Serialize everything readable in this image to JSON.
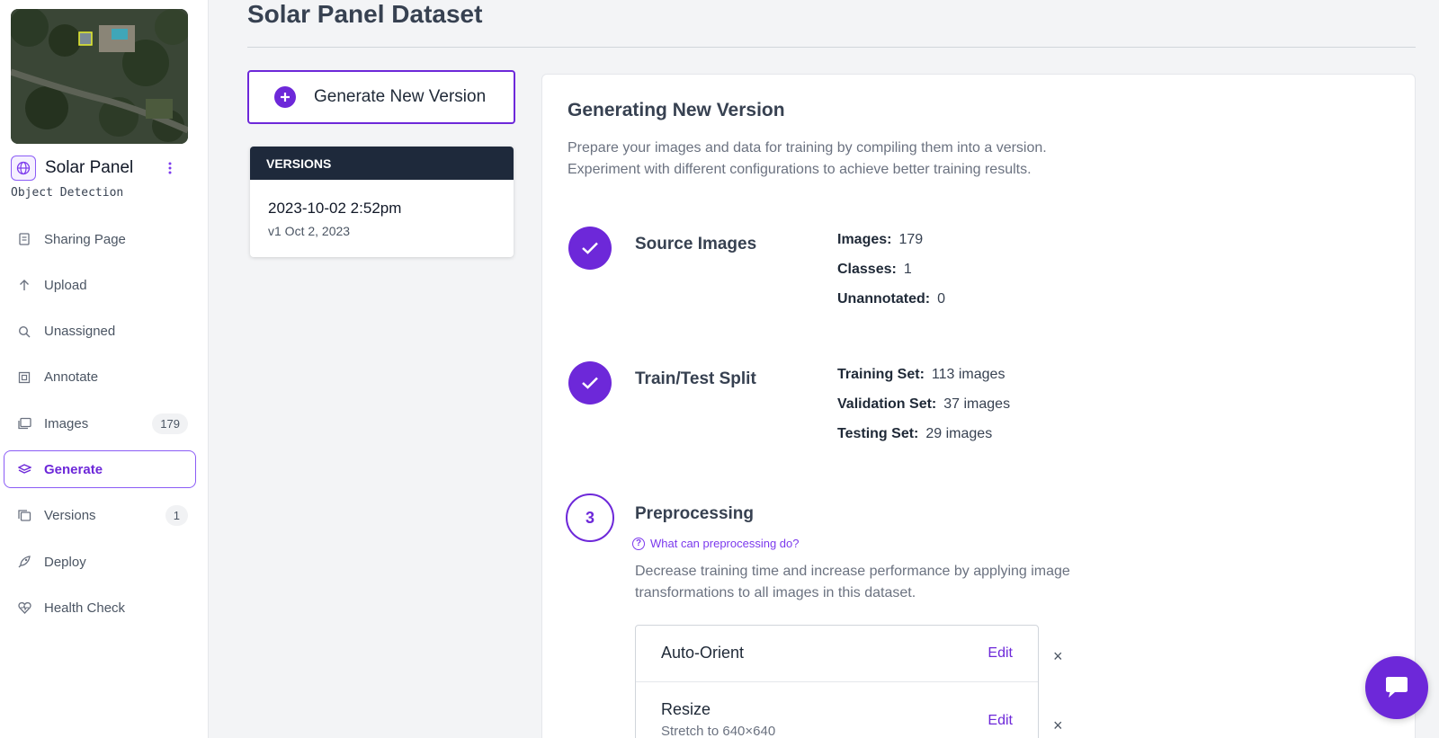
{
  "sidebar": {
    "project_name": "Solar Panel",
    "project_type": "Object Detection",
    "items": [
      {
        "label": "Sharing Page",
        "icon": "document-icon"
      },
      {
        "label": "Upload",
        "icon": "arrow-up-icon"
      },
      {
        "label": "Unassigned",
        "icon": "search-icon"
      },
      {
        "label": "Annotate",
        "icon": "annotate-icon"
      },
      {
        "label": "Images",
        "icon": "images-icon",
        "count": "179"
      },
      {
        "label": "Generate",
        "icon": "generate-icon",
        "active": true
      },
      {
        "label": "Versions",
        "icon": "versions-icon",
        "count": "1"
      },
      {
        "label": "Deploy",
        "icon": "rocket-icon"
      },
      {
        "label": "Health Check",
        "icon": "heart-pulse-icon"
      }
    ]
  },
  "main": {
    "title": "Solar Panel Dataset",
    "generate_button": "Generate New Version",
    "versions": {
      "header": "VERSIONS",
      "items": [
        {
          "name": "2023-10-02 2:52pm",
          "sub": "v1 Oct 2, 2023"
        }
      ]
    }
  },
  "panel": {
    "title": "Generating New Version",
    "desc_line1": "Prepare your images and data for training by compiling them into a version.",
    "desc_line2": "Experiment with different configurations to achieve better training results.",
    "source": {
      "title": "Source Images",
      "images_k": "Images:",
      "images_v": "179",
      "classes_k": "Classes:",
      "classes_v": "1",
      "unannotated_k": "Unannotated:",
      "unannotated_v": "0"
    },
    "split": {
      "title": "Train/Test Split",
      "train_k": "Training Set:",
      "train_v": "113 images",
      "valid_k": "Validation Set:",
      "valid_v": "37 images",
      "test_k": "Testing Set:",
      "test_v": "29 images"
    },
    "preprocessing": {
      "step": "3",
      "title": "Preprocessing",
      "help": "What can preprocessing do?",
      "desc_line1": "Decrease training time and increase performance by applying image",
      "desc_line2": "transformations to all images in this dataset.",
      "options": [
        {
          "name": "Auto-Orient",
          "sub": "",
          "edit": "Edit",
          "remove": "×"
        },
        {
          "name": "Resize",
          "sub": "Stretch to 640×640",
          "edit": "Edit",
          "remove": "×"
        }
      ]
    }
  },
  "colors": {
    "accent": "#6d28d9",
    "sidebar_header": "#1e293b"
  }
}
